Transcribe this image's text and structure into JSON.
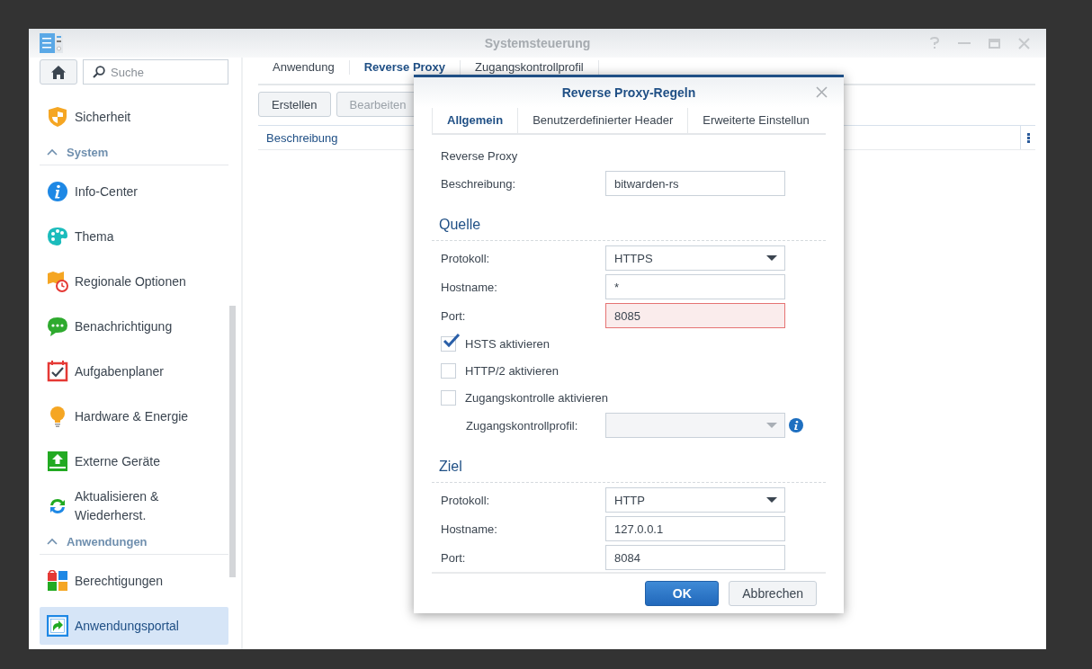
{
  "window": {
    "title": "Systemsteuerung"
  },
  "sidebar": {
    "search": {
      "placeholder": "Suche"
    },
    "items": [
      {
        "kind": "item",
        "label": "Sicherheit",
        "selected": false
      },
      {
        "kind": "header",
        "label": "System",
        "expanded": true
      },
      {
        "kind": "item",
        "label": "Info-Center",
        "selected": false
      },
      {
        "kind": "item",
        "label": "Thema",
        "selected": false
      },
      {
        "kind": "item",
        "label": "Regionale Optionen",
        "selected": false
      },
      {
        "kind": "item",
        "label": "Benachrichtigung",
        "selected": false
      },
      {
        "kind": "item",
        "label": "Aufgabenplaner",
        "selected": false
      },
      {
        "kind": "item",
        "label": "Hardware & Energie",
        "selected": false
      },
      {
        "kind": "item",
        "label": "Externe Geräte",
        "selected": false
      },
      {
        "kind": "item",
        "label": "Aktualisieren & Wiederherst.",
        "selected": false
      },
      {
        "kind": "header",
        "label": "Anwendungen",
        "expanded": true
      },
      {
        "kind": "item",
        "label": "Berechtigungen",
        "selected": false
      },
      {
        "kind": "item",
        "label": "Anwendungsportal",
        "selected": true
      }
    ]
  },
  "tabs": [
    {
      "label": "Anwendung",
      "selected": false
    },
    {
      "label": "Reverse Proxy",
      "selected": true
    },
    {
      "label": "Zugangskontrollprofil",
      "selected": false
    }
  ],
  "toolbar": [
    {
      "label": "Erstellen",
      "disabled": false
    },
    {
      "label": "Bearbeiten",
      "disabled": true
    }
  ],
  "table": {
    "columns": [
      "Beschreibung"
    ]
  },
  "dialog": {
    "title": "Reverse Proxy-Regeln",
    "tabs": [
      {
        "label": "Allgemein",
        "selected": true
      },
      {
        "label": "Benutzerdefinierter Header",
        "selected": false
      },
      {
        "label": "Erweiterte Einstellun",
        "selected": false
      }
    ],
    "rows": [
      {
        "kind": "note",
        "label": "Reverse Proxy"
      },
      {
        "kind": "field",
        "label": "Beschreibung:",
        "value": "bitwarden-rs",
        "error": false
      },
      {
        "kind": "heading",
        "label": "Quelle"
      },
      {
        "kind": "select",
        "label": "Protokoll:",
        "value": "HTTPS",
        "disabled": false
      },
      {
        "kind": "field",
        "label": "Hostname:",
        "value": "*",
        "error": false
      },
      {
        "kind": "field",
        "label": "Port:",
        "value": "8085",
        "error": true
      },
      {
        "kind": "checkbox",
        "label": "HSTS aktivieren",
        "checked": true
      },
      {
        "kind": "checkbox",
        "label": "HTTP/2 aktivieren",
        "checked": false
      },
      {
        "kind": "checkbox",
        "label": "Zugangskontrolle aktivieren",
        "checked": false
      },
      {
        "kind": "select",
        "label": "Zugangskontrollprofil:",
        "value": "",
        "disabled": true,
        "indented": true,
        "info": true
      },
      {
        "kind": "heading",
        "label": "Ziel"
      },
      {
        "kind": "select",
        "label": "Protokoll:",
        "value": "HTTP",
        "disabled": false
      },
      {
        "kind": "field",
        "label": "Hostname:",
        "value": "127.0.0.1",
        "error": false
      },
      {
        "kind": "field",
        "label": "Port:",
        "value": "8084",
        "error": false
      }
    ],
    "buttons": [
      {
        "label": "OK",
        "primary": true
      },
      {
        "label": "Abbrechen",
        "primary": false
      }
    ]
  }
}
